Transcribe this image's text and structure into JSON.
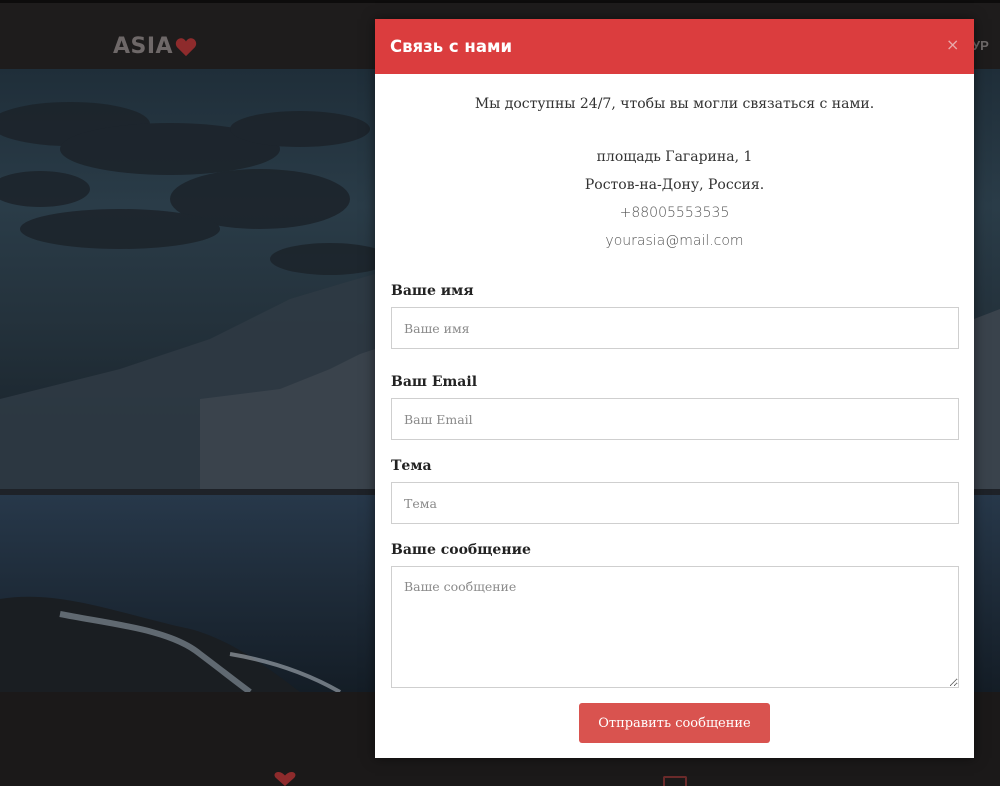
{
  "page": {
    "logo_text": "ASIA",
    "nav_partial_text": "УР",
    "accent_color": "#db3d3e"
  },
  "modal": {
    "title": "Связь с нами",
    "close_symbol": "×",
    "availability": "Мы доступны 24/7, чтобы вы могли связаться с нами.",
    "address_line1": "площадь Гагарина, 1",
    "address_line2": "Ростов-на-Дону, Россия.",
    "phone": "+88005553535",
    "email": "yourasia@mail.com",
    "fields": {
      "name": {
        "label": "Ваше имя",
        "placeholder": "Ваше имя",
        "value": ""
      },
      "email": {
        "label": "Ваш Email",
        "placeholder": "Ваш Email",
        "value": ""
      },
      "subject": {
        "label": "Тема",
        "placeholder": "Тема",
        "value": ""
      },
      "message": {
        "label": "Ваше сообщение",
        "placeholder": "Ваше сообщение",
        "value": ""
      }
    },
    "submit_label": "Отправить сообщение"
  },
  "icons": {
    "logo": "heart-icon",
    "close": "close-icon",
    "strip_left": "heart-icon",
    "strip_right": "box-icon"
  }
}
